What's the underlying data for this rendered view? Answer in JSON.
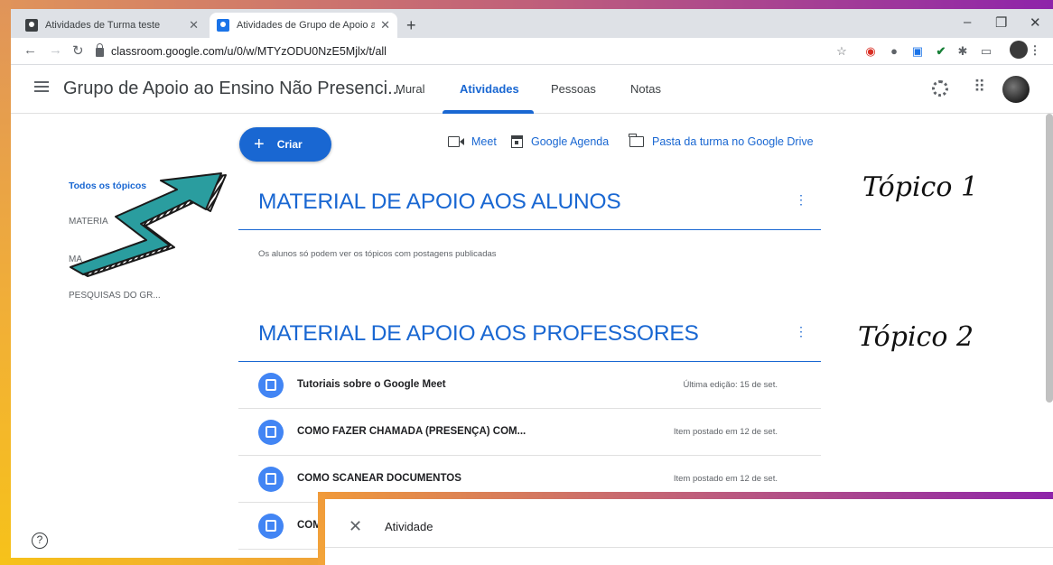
{
  "browser": {
    "tabs": [
      {
        "label": "Atividades de Turma teste"
      },
      {
        "label": "Atividades de Grupo de Apoio ao"
      }
    ],
    "new_tab_symbol": "+",
    "url": "classroom.google.com/u/0/w/MTYzODU0NzE5Mjlx/t/all"
  },
  "header": {
    "class_title": "Grupo de Apoio ao Ensino Não Presenci...",
    "tabs": [
      {
        "label": "Mural"
      },
      {
        "label": "Atividades"
      },
      {
        "label": "Pessoas"
      },
      {
        "label": "Notas"
      }
    ]
  },
  "toolbar": {
    "create_label": "Criar",
    "meet_label": "Meet",
    "calendar_label": "Google Agenda",
    "drive_label": "Pasta da turma no Google Drive"
  },
  "sidebar": {
    "topics": [
      {
        "label": "Todos os tópicos"
      },
      {
        "label": "MATERIA"
      },
      {
        "label": "MA"
      },
      {
        "label": "PESQUISAS DO GR..."
      }
    ]
  },
  "topics": [
    {
      "title": "MATERIAL DE APOIO AOS ALUNOS",
      "annotation": "Tópico 1"
    },
    {
      "title": "MATERIAL DE APOIO AOS PROFESSORES",
      "annotation": "Tópico 2"
    }
  ],
  "notice": "Os alunos só podem ver os tópicos com postagens publicadas",
  "materials": [
    {
      "title": "Tutoriais sobre o Google Meet",
      "meta": "Última edição: 15 de set."
    },
    {
      "title": "COMO FAZER CHAMADA (PRESENÇA) COM...",
      "meta": "Item postado em 12 de set."
    },
    {
      "title": "COMO SCANEAR DOCUMENTOS",
      "meta": "Item postado em 12 de set."
    },
    {
      "title": "COM",
      "meta": ""
    }
  ],
  "overlay": {
    "title": "Atividade",
    "close_symbol": "✕"
  },
  "colors": {
    "accent": "#1967d2",
    "material_icon": "#4285f4",
    "arrow_fill": "#2a9d9f"
  }
}
